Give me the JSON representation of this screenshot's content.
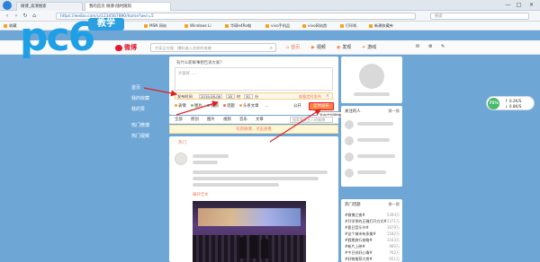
{
  "browser": {
    "tabs": [
      "微博_高清搜索",
      "我的首页 微博-随时随刻"
    ],
    "window_controls": [
      "—",
      "□",
      "✕"
    ],
    "url": "https://weibo.com/u/1234567890/home?wvr=5",
    "search_placeholder": "搜索",
    "favorites": [
      "收藏",
      "MSN 网站",
      "Windows Li",
      "华硕e4Ro电",
      "vivo手机品",
      "vivo网站首",
      "打印机",
      "新建收藏夹"
    ]
  },
  "watermark": {
    "letters": "pc6",
    "badge": "教学"
  },
  "weibo_nav": {
    "logo": "微博",
    "search_placeholder": "大家正在搜：爆料逃入花样的攻略",
    "items": [
      "首页",
      "视频",
      "发现",
      "游戏"
    ]
  },
  "left_nav": {
    "items": [
      "首页",
      "我的收藏",
      "我的赞",
      "热门微博",
      "热门视频"
    ]
  },
  "publisher": {
    "header": "有什么新鲜事想告诉大家？",
    "placeholder": "大家好……",
    "time_label": "发布时间",
    "date_value": "2019-08-06",
    "hour_value": "18",
    "minute_value": "30",
    "time_sep_hour": "时",
    "time_sep_min": "分",
    "time_link": "查看定时发布",
    "close": "×",
    "tools": [
      "表情",
      "图片",
      "视频",
      "话题",
      "头条文章",
      "…"
    ],
    "scope": "公开",
    "post_button": "定时发布",
    "tooltip": "发布定时微博"
  },
  "feed_tabs": {
    "items": [
      "全部",
      "原创",
      "图片",
      "视频",
      "音乐",
      "文章"
    ],
    "search_placeholder": "搜索我关注人的微博"
  },
  "notice": "有新微博，点击查看",
  "feed_card": {
    "hot_label": "热门",
    "link": "展开全文"
  },
  "right_column": {
    "block1": {
      "title": "关注的人",
      "more": "换一换"
    },
    "block2": {
      "title": "热门话题",
      "more": "换一换",
      "items": [
        {
          "label": "#微博之夜#",
          "count": "5394万"
        },
        {
          "label": "#开学季的正确打开方式#",
          "count": "2371万"
        },
        {
          "label": "#夏日音乐节#",
          "count": "1879万"
        },
        {
          "label": "#这个城市有多美#",
          "count": "1582万"
        },
        {
          "label": "#假期旅行攻略#",
          "count": "1163万"
        },
        {
          "label": "#新片上映#",
          "count": "980万"
        },
        {
          "label": "#今日份好心情#",
          "count": "762万"
        },
        {
          "label": "#好物推荐大赏#",
          "count": "651万"
        }
      ]
    }
  },
  "speed_widget": {
    "percent": "75%",
    "upload": "↑ 0.2K/S",
    "download": "↓ 0.8K/S"
  }
}
